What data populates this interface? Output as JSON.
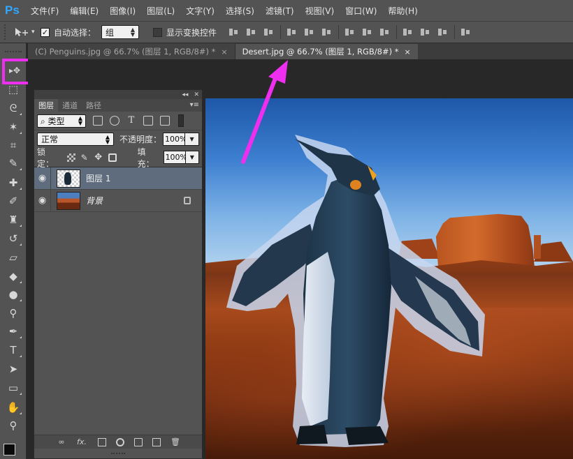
{
  "app": {
    "logo": "Ps"
  },
  "menu": {
    "items": [
      "文件(F)",
      "编辑(E)",
      "图像(I)",
      "图层(L)",
      "文字(Y)",
      "选择(S)",
      "滤镜(T)",
      "视图(V)",
      "窗口(W)",
      "帮助(H)"
    ]
  },
  "options_bar": {
    "tool_icon": "move-tool-icon",
    "auto_select_checked": true,
    "auto_select_label": "自动选择：",
    "auto_select_target": "组",
    "transform_controls_checked": false,
    "transform_controls_label": "显示变换控件"
  },
  "document_tabs": [
    {
      "title": "(C) Penguins.jpg @ 66.7% (图层 1, RGB/8#) *",
      "close": "×",
      "active": false
    },
    {
      "title": "Desert.jpg @ 66.7% (图层 1, RGB/8#) *",
      "close": "×",
      "active": true
    }
  ],
  "toolbar": {
    "tools": [
      {
        "name": "move-tool-icon",
        "glyph": "▸✥"
      },
      {
        "name": "marquee-tool-icon",
        "glyph": "⬚"
      },
      {
        "name": "lasso-tool-icon",
        "glyph": "ᘓ"
      },
      {
        "name": "magic-wand-tool-icon",
        "glyph": "✶"
      },
      {
        "name": "crop-tool-icon",
        "glyph": "⌗"
      },
      {
        "name": "eyedropper-tool-icon",
        "glyph": "✎"
      },
      {
        "name": "healing-brush-tool-icon",
        "glyph": "✚"
      },
      {
        "name": "brush-tool-icon",
        "glyph": "✐"
      },
      {
        "name": "clone-stamp-tool-icon",
        "glyph": "♜"
      },
      {
        "name": "history-brush-tool-icon",
        "glyph": "↺"
      },
      {
        "name": "eraser-tool-icon",
        "glyph": "▱"
      },
      {
        "name": "paint-bucket-tool-icon",
        "glyph": "◆"
      },
      {
        "name": "blur-tool-icon",
        "glyph": "●"
      },
      {
        "name": "dodge-tool-icon",
        "glyph": "⚲"
      },
      {
        "name": "pen-tool-icon",
        "glyph": "✒"
      },
      {
        "name": "type-tool-icon",
        "glyph": "T"
      },
      {
        "name": "path-selection-tool-icon",
        "glyph": "➤"
      },
      {
        "name": "shape-tool-icon",
        "glyph": "▭"
      },
      {
        "name": "hand-tool-icon",
        "glyph": "✋"
      },
      {
        "name": "zoom-tool-icon",
        "glyph": "⚲"
      }
    ],
    "foreground_color": "#000000",
    "background_color": "#ffffff"
  },
  "layers_panel": {
    "tabs": [
      {
        "label": "图层",
        "active": true
      },
      {
        "label": "通道",
        "active": false
      },
      {
        "label": "路径",
        "active": false
      }
    ],
    "collapse_glyph": "◂◂",
    "close_glyph": "✕",
    "menu_glyph": "▾≡",
    "filter_kind": "⌕ 类型",
    "blend_mode": "正常",
    "opacity_label": "不透明度：",
    "opacity_value": "100%",
    "lock_label": "锁定：",
    "fill_label": "填充：",
    "fill_value": "100%",
    "layers": [
      {
        "name": "图层 1",
        "visible": true,
        "selected": true,
        "locked": false
      },
      {
        "name": "背景",
        "visible": true,
        "selected": false,
        "locked": true
      }
    ],
    "bottom_icons": [
      "link-layers-icon",
      "fx-icon",
      "add-mask-icon",
      "adjustment-layer-icon",
      "new-group-icon",
      "new-layer-icon",
      "delete-layer-icon"
    ],
    "fx_label": "fx."
  },
  "annotations": {
    "highlight_color": "#ef2ff0",
    "arrow_color": "#ef2ff0"
  }
}
